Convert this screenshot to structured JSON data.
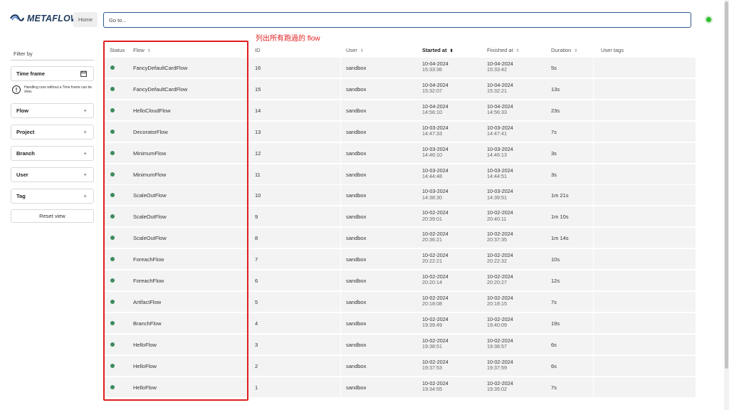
{
  "header": {
    "logo_text": "METAFLOW",
    "home_label": "Home",
    "goto_placeholder": "Go to...",
    "status_color": "#2fc02f"
  },
  "sidebar": {
    "filter_title": "Filter by",
    "time_frame_label": "Time frame",
    "warning_text": "Handling runs without a Time frame can be slow.",
    "filters": [
      {
        "label": "Flow"
      },
      {
        "label": "Project"
      },
      {
        "label": "Branch"
      },
      {
        "label": "User"
      },
      {
        "label": "Tag"
      }
    ],
    "reset_label": "Reset view"
  },
  "annotation": "列出所有跑過的 flow",
  "table": {
    "headers": {
      "status": "Status",
      "flow": "Flow",
      "id": "ID",
      "user": "User",
      "started": "Started at",
      "finished": "Finished at",
      "duration": "Duration",
      "tags": "User tags"
    },
    "rows": [
      {
        "flow": "FancyDefaultCardFlow",
        "id": "16",
        "user": "sandbox",
        "start_date": "10-04-2024",
        "start_time": "15:33:36",
        "end_date": "10-04-2024",
        "end_time": "15:33:42",
        "duration": "5s"
      },
      {
        "flow": "FancyDefaultCardFlow",
        "id": "15",
        "user": "sandbox",
        "start_date": "10-04-2024",
        "start_time": "15:32:07",
        "end_date": "10-04-2024",
        "end_time": "15:32:21",
        "duration": "13s"
      },
      {
        "flow": "HelloCloudFlow",
        "id": "14",
        "user": "sandbox",
        "start_date": "10-04-2024",
        "start_time": "14:56:10",
        "end_date": "10-04-2024",
        "end_time": "14:56:33",
        "duration": "23s"
      },
      {
        "flow": "DecoratorFlow",
        "id": "13",
        "user": "sandbox",
        "start_date": "10-03-2024",
        "start_time": "14:47:33",
        "end_date": "10-03-2024",
        "end_time": "14:47:41",
        "duration": "7s"
      },
      {
        "flow": "MinimumFlow",
        "id": "12",
        "user": "sandbox",
        "start_date": "10-03-2024",
        "start_time": "14:46:10",
        "end_date": "10-03-2024",
        "end_time": "14:46:13",
        "duration": "3s"
      },
      {
        "flow": "MinimumFlow",
        "id": "11",
        "user": "sandbox",
        "start_date": "10-03-2024",
        "start_time": "14:44:48",
        "end_date": "10-03-2024",
        "end_time": "14:44:51",
        "duration": "3s"
      },
      {
        "flow": "ScaleOutFlow",
        "id": "10",
        "user": "sandbox",
        "start_date": "10-03-2024",
        "start_time": "14:38:30",
        "end_date": "10-03-2024",
        "end_time": "14:39:51",
        "duration": "1m 21s"
      },
      {
        "flow": "ScaleOutFlow",
        "id": "9",
        "user": "sandbox",
        "start_date": "10-02-2024",
        "start_time": "20:39:01",
        "end_date": "10-02-2024",
        "end_time": "20:40:11",
        "duration": "1m 10s"
      },
      {
        "flow": "ScaleOutFlow",
        "id": "8",
        "user": "sandbox",
        "start_date": "10-02-2024",
        "start_time": "20:36:21",
        "end_date": "10-02-2024",
        "end_time": "20:37:35",
        "duration": "1m 14s"
      },
      {
        "flow": "ForeachFlow",
        "id": "7",
        "user": "sandbox",
        "start_date": "10-02-2024",
        "start_time": "20:22:21",
        "end_date": "10-02-2024",
        "end_time": "20:22:32",
        "duration": "10s"
      },
      {
        "flow": "ForeachFlow",
        "id": "6",
        "user": "sandbox",
        "start_date": "10-02-2024",
        "start_time": "20:20:14",
        "end_date": "10-02-2024",
        "end_time": "20:20:27",
        "duration": "12s"
      },
      {
        "flow": "ArtifactFlow",
        "id": "5",
        "user": "sandbox",
        "start_date": "10-02-2024",
        "start_time": "20:18:08",
        "end_date": "10-02-2024",
        "end_time": "20:18:15",
        "duration": "7s"
      },
      {
        "flow": "BranchFlow",
        "id": "4",
        "user": "sandbox",
        "start_date": "10-02-2024",
        "start_time": "19:39:49",
        "end_date": "10-02-2024",
        "end_time": "19:40:09",
        "duration": "19s"
      },
      {
        "flow": "HelloFlow",
        "id": "3",
        "user": "sandbox",
        "start_date": "10-02-2024",
        "start_time": "19:38:51",
        "end_date": "10-02-2024",
        "end_time": "19:38:57",
        "duration": "6s"
      },
      {
        "flow": "HelloFlow",
        "id": "2",
        "user": "sandbox",
        "start_date": "10-02-2024",
        "start_time": "19:37:53",
        "end_date": "10-02-2024",
        "end_time": "19:37:59",
        "duration": "6s"
      },
      {
        "flow": "HelloFlow",
        "id": "1",
        "user": "sandbox",
        "start_date": "10-02-2024",
        "start_time": "19:34:55",
        "end_date": "10-02-2024",
        "end_time": "19:35:02",
        "duration": "7s"
      }
    ]
  }
}
